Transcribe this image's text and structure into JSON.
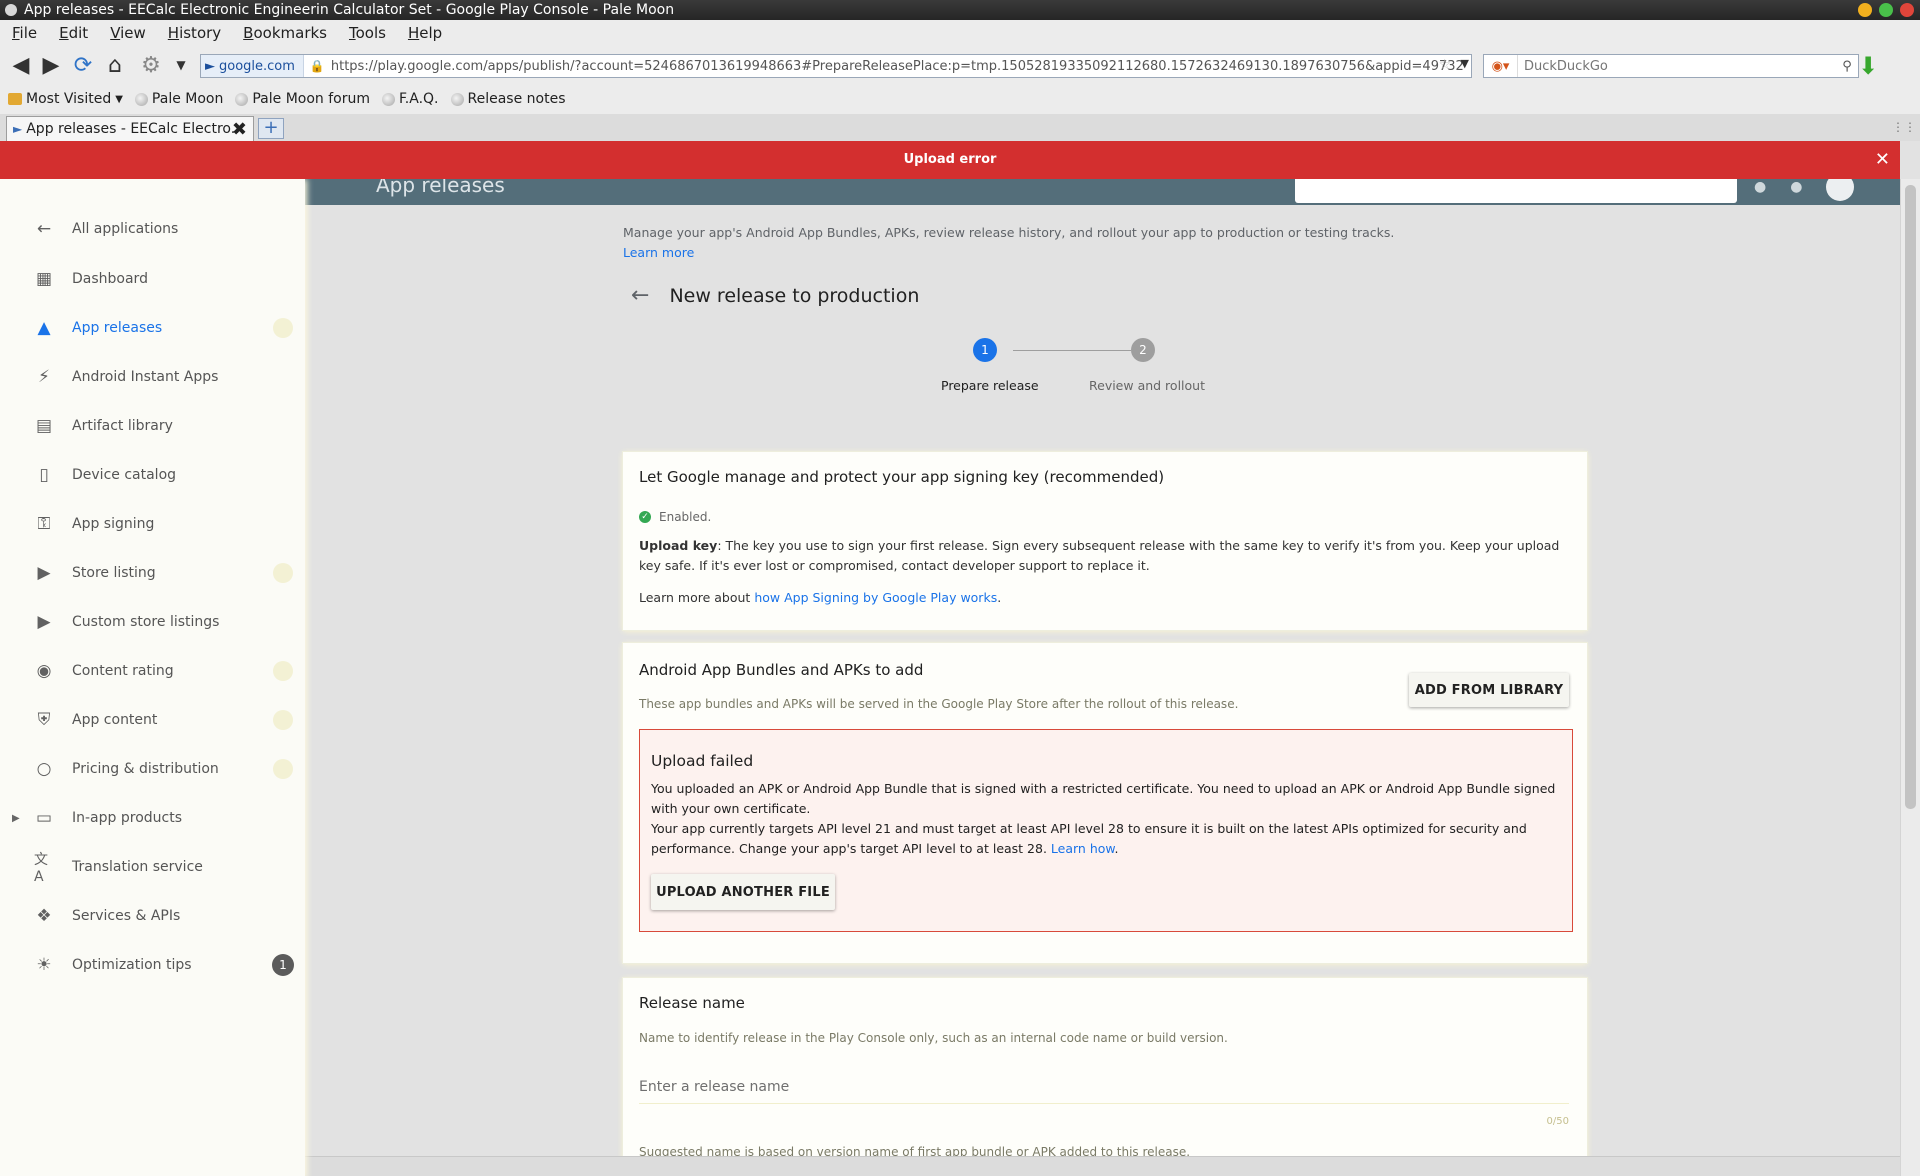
{
  "window": {
    "title": "App releases - EECalc Electronic Engineerin Calculator Set - Google Play Console - Pale Moon",
    "controls_colors": [
      "#f2b01e",
      "#49c04a",
      "#e0453a"
    ]
  },
  "menu": [
    "File",
    "Edit",
    "View",
    "History",
    "Bookmarks",
    "Tools",
    "Help"
  ],
  "navbar": {
    "site_identity": "google.com",
    "url": "https://play.google.com/apps/publish/?account=5246867013619948663#PrepareReleasePlace:p=tmp.15052819335092112680.1572632469130.1897630756&appid=49732",
    "search_placeholder": "DuckDuckGo"
  },
  "bookmarks": [
    "Most Visited",
    "Pale Moon",
    "Pale Moon forum",
    "F.A.Q.",
    "Release notes"
  ],
  "tab": {
    "title": "App releases - EECalc Electro..."
  },
  "banner": {
    "text": "Upload error",
    "color": "#d32f2f"
  },
  "appbar": {
    "title": "App releases"
  },
  "sidebar": {
    "items": [
      {
        "label": "All applications",
        "icon": "arrow-left-icon"
      },
      {
        "label": "Dashboard",
        "icon": "dashboard-icon"
      },
      {
        "label": "App releases",
        "icon": "rocket-icon",
        "active": true
      },
      {
        "label": "Android Instant Apps",
        "icon": "bolt-icon"
      },
      {
        "label": "Artifact library",
        "icon": "library-icon"
      },
      {
        "label": "Device catalog",
        "icon": "device-icon"
      },
      {
        "label": "App signing",
        "icon": "key-icon"
      },
      {
        "label": "Store listing",
        "icon": "store-icon"
      },
      {
        "label": "Custom store listings",
        "icon": "store-icon"
      },
      {
        "label": "Content rating",
        "icon": "rating-icon"
      },
      {
        "label": "App content",
        "icon": "shield-icon"
      },
      {
        "label": "Pricing & distribution",
        "icon": "globe-icon"
      },
      {
        "label": "In-app products",
        "icon": "card-icon"
      },
      {
        "label": "Translation service",
        "icon": "translate-icon"
      },
      {
        "label": "Services & APIs",
        "icon": "api-icon"
      },
      {
        "label": "Optimization tips",
        "icon": "bulb-icon",
        "badge": "1"
      }
    ]
  },
  "main": {
    "intro": "Manage your app's Android App Bundles, APKs, review release history, and rollout your app to production or testing tracks.",
    "learn_more": "Learn more",
    "title": "New release to production",
    "steps": [
      {
        "number": "1",
        "label": "Prepare release",
        "color": "#1a73e8"
      },
      {
        "number": "2",
        "label": "Review and rollout",
        "color": "#9e9e9e"
      }
    ],
    "signing_card": {
      "title": "Let Google manage and protect your app signing key (recommended)",
      "status": "Enabled.",
      "upload_key_label": "Upload key",
      "upload_key_text": ": The key you use to sign your first release. Sign every subsequent release with the same key to verify it's from you. Keep your upload key safe. If it's ever lost or compromised, contact developer support to replace it.",
      "learn_prefix": "Learn more about ",
      "learn_link": "how App Signing by Google Play works",
      "learn_suffix": "."
    },
    "bundles_card": {
      "title": "Android App Bundles and APKs to add",
      "subtitle": "These app bundles and APKs will be served in the Google Play Store after the rollout of this release.",
      "add_button": "ADD FROM LIBRARY",
      "error": {
        "title": "Upload failed",
        "line1": "You uploaded an APK or Android App Bundle that is signed with a restricted certificate. You need to upload an APK or Android App Bundle signed with your own certificate.",
        "line2": "Your app currently targets API level 21 and must target at least API level 28 to ensure it is built on the latest APIs optimized for security and performance. Change your app's target API level to at least 28. ",
        "link": "Learn how",
        "link_suffix": ".",
        "button": "UPLOAD ANOTHER FILE"
      }
    },
    "release_name_card": {
      "title": "Release name",
      "subtitle": "Name to identify release in the Play Console only, such as an internal code name or build version.",
      "placeholder": "Enter a release name",
      "counter": "0/50",
      "hint": "Suggested name is based on version name of first app bundle or APK added to this release."
    }
  }
}
